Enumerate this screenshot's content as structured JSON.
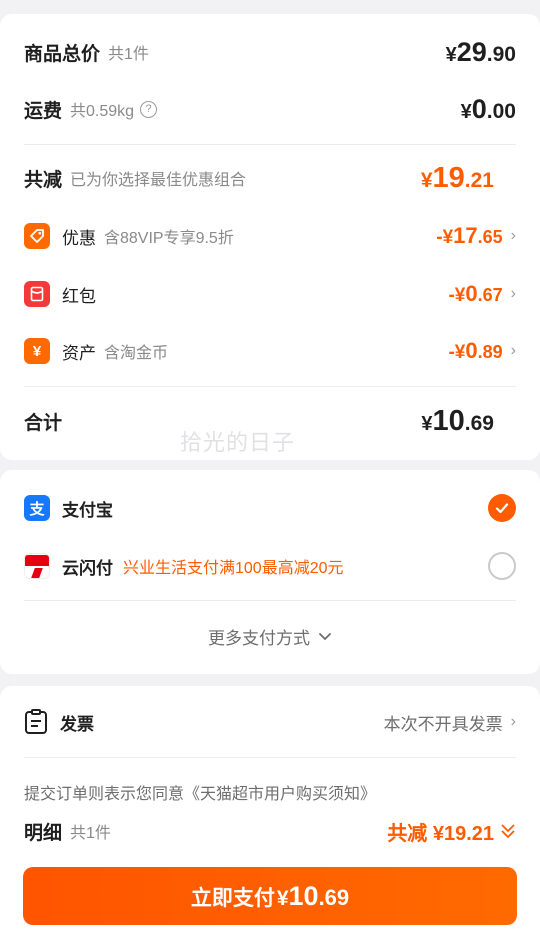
{
  "summary": {
    "goods_total": {
      "label": "商品总价",
      "count": "共1件",
      "symbol": "¥",
      "int": "29",
      "dec": ".90"
    },
    "shipping": {
      "label": "运费",
      "weight": "共0.59kg",
      "help": "?",
      "symbol": "¥",
      "int": "0",
      "dec": ".00"
    },
    "discount_total": {
      "label": "共减",
      "note": "已为你选择最佳优惠组合",
      "symbol": "¥",
      "int": "19",
      "dec": ".21"
    },
    "coupon": {
      "label": "优惠",
      "note": "含88VIP专享9.5折",
      "prefix": "-¥",
      "int": "17",
      "dec": ".65"
    },
    "redpacket": {
      "label": "红包",
      "prefix": "-¥",
      "int": "0",
      "dec": ".67"
    },
    "assets": {
      "label": "资产",
      "note": "含淘金币",
      "prefix": "-¥",
      "int": "0",
      "dec": ".89"
    },
    "grand_total": {
      "label": "合计",
      "symbol": "¥",
      "int": "10",
      "dec": ".69"
    }
  },
  "watermark": "拾光的日子",
  "payment": {
    "alipay": {
      "label": "支付宝",
      "selected": true
    },
    "unionpay": {
      "label": "云闪付",
      "promo": "兴业生活支付满100最高减20元",
      "selected": false
    },
    "more": "更多支付方式"
  },
  "invoice": {
    "label": "发票",
    "value": "本次不开具发票"
  },
  "agreement": "提交订单则表示您同意《天猫超市用户购买须知》",
  "detail": {
    "label": "明细",
    "count": "共1件",
    "saving": "共减 ¥19.21"
  },
  "pay_button": {
    "text": "立即支付",
    "symbol": "¥",
    "int": "10",
    "dec": ".69"
  },
  "colors": {
    "accent": "#ff5b00",
    "background": "#f2f2f4",
    "alipay_blue": "#1677ff"
  },
  "icons": [
    "help-icon",
    "coupon-tag-icon",
    "redpacket-icon",
    "yuan-coin-icon",
    "chevron-right-icon",
    "alipay-icon",
    "unionpay-icon",
    "check-icon",
    "chevron-down-icon",
    "invoice-icon",
    "double-chevron-down-icon"
  ]
}
